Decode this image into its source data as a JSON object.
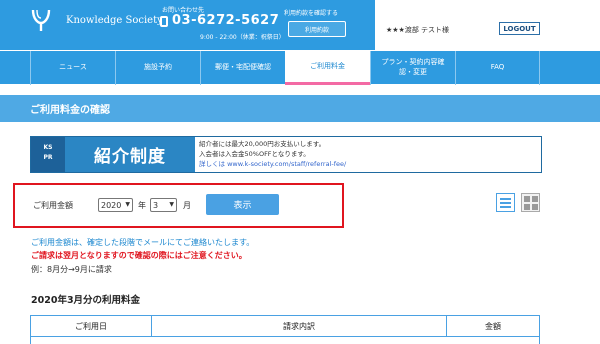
{
  "header": {
    "logo_text": "Knowledge Society",
    "contact_label": "お問い合わせ先",
    "phone": "03-6272-5627",
    "hours": "9:00 - 22:00（休業：祝祭日）",
    "usage_note": "利用約款を確認する",
    "usage_button": "利用約款",
    "user_name": "★★★渡部 テスト様",
    "logout": "LOGOUT",
    "brand_color": "#2e9be0"
  },
  "nav": {
    "items": [
      {
        "label": "ニュース"
      },
      {
        "label": "施設予約"
      },
      {
        "label": "郵便・宅配便確認"
      },
      {
        "label": "ご利用料金"
      },
      {
        "label": "プラン・契約内容確認・変更"
      },
      {
        "label": "FAQ"
      }
    ],
    "active": "ご利用料金"
  },
  "section": {
    "title": "ご利用料金の確認"
  },
  "banner": {
    "ks": "KS",
    "pr": "PR",
    "title": "紹介制度",
    "line1": "紹介者には最大20,000円お支払いします。",
    "line2": "入会者は入会金50%OFFとなります。",
    "link": "詳しくは www.k-society.com/staff/referral-fee/"
  },
  "form": {
    "label": "ご利用金額",
    "year_value": "2020",
    "year_unit": "年",
    "month_value": "3",
    "month_unit": "月",
    "show_button": "表示"
  },
  "view_toggle": {
    "list_icon": "list-view-icon",
    "grid_icon": "grid-view-icon",
    "active": "list"
  },
  "notices": {
    "info": "ご利用金額は、確定した段階でメールにてご連絡いたします。",
    "warning": "ご請求は翌月となりますので確認の際にはご注意ください。",
    "example": "例：8月分→9月に請求"
  },
  "billing": {
    "title": "2020年3月分の利用料金",
    "columns": [
      "ご利用日",
      "請求内訳",
      "金額"
    ]
  }
}
